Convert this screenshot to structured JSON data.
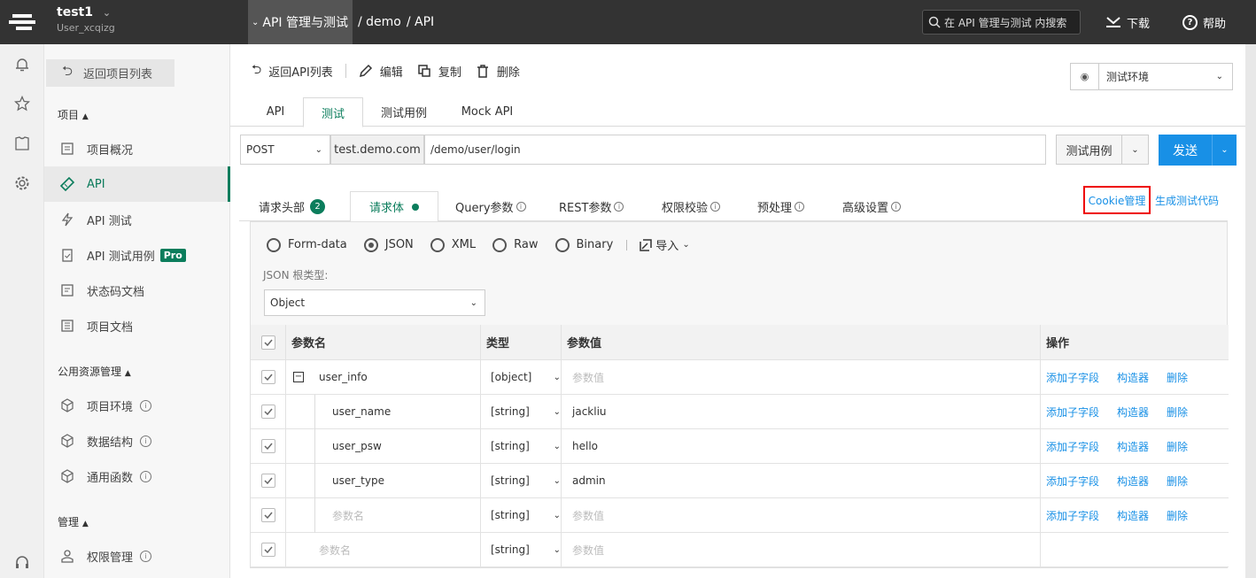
{
  "topbar": {
    "project_name": "test1",
    "user_name": "User_xcqizg",
    "breadcrumb": [
      "API 管理与测试",
      "/ demo",
      "/ API"
    ],
    "search_placeholder": "在 API 管理与测试 内搜索",
    "download_label": "下载",
    "help_label": "帮助"
  },
  "sidebar": {
    "back_label": "返回项目列表",
    "section_project": "项目",
    "section_public": "公用资源管理",
    "section_manage": "管理",
    "items": [
      {
        "label": "项目概况",
        "icon": "overview-icon"
      },
      {
        "label": "API",
        "icon": "api-icon",
        "active": true
      },
      {
        "label": "API 测试",
        "icon": "lightning-icon"
      },
      {
        "label": "API 测试用例",
        "icon": "testcase-icon",
        "badge": "Pro"
      },
      {
        "label": "状态码文档",
        "icon": "doc-icon"
      },
      {
        "label": "项目文档",
        "icon": "list-doc-icon"
      },
      {
        "label": "项目环境",
        "icon": "cube-icon"
      },
      {
        "label": "数据结构",
        "icon": "cube-icon"
      },
      {
        "label": "通用函数",
        "icon": "cube-icon"
      },
      {
        "label": "权限管理",
        "icon": "user-icon"
      }
    ]
  },
  "toolbar": {
    "back_api_list": "返回API列表",
    "edit": "编辑",
    "copy": "复制",
    "delete": "删除",
    "env_selected": "测试环境"
  },
  "tabs_main": [
    "API",
    "测试",
    "测试用例",
    "Mock API"
  ],
  "request": {
    "method": "POST",
    "host": "test.demo.com",
    "path": "/demo/user/login",
    "testcase_btn": "测试用例",
    "send_btn": "发送"
  },
  "tabs_req": {
    "headers": "请求头部",
    "headers_count": "2",
    "body": "请求体",
    "query": "Query参数",
    "rest": "REST参数",
    "auth": "权限校验",
    "pre": "预处理",
    "advanced": "高级设置",
    "info_mark": "i",
    "cookie": "Cookie管理",
    "gencode": "生成测试代码"
  },
  "body": {
    "formats": [
      "Form-data",
      "JSON",
      "XML",
      "Raw",
      "Binary"
    ],
    "selected_format": "JSON",
    "import_label": "导入",
    "json_root_label": "JSON 根类型:",
    "json_root_value": "Object",
    "columns": [
      "参数名",
      "类型",
      "参数值",
      "操作"
    ],
    "rows": [
      {
        "name": "user_info",
        "type": "[object]",
        "value": "参数值",
        "value_placeholder": true,
        "level": 0,
        "expander": true,
        "actions": true
      },
      {
        "name": "user_name",
        "type": "[string]",
        "value": "jackliu",
        "level": 1,
        "actions": true
      },
      {
        "name": "user_psw",
        "type": "[string]",
        "value": "hello",
        "level": 1,
        "actions": true
      },
      {
        "name": "user_type",
        "type": "[string]",
        "value": "admin",
        "level": 1,
        "actions": true
      },
      {
        "name": "参数名",
        "name_placeholder": true,
        "type": "[string]",
        "value": "参数值",
        "value_placeholder": true,
        "level": 1,
        "actions": true
      },
      {
        "name": "参数名",
        "name_placeholder": true,
        "type": "[string]",
        "value": "参数值",
        "value_placeholder": true,
        "level": 0,
        "actions": false
      }
    ],
    "actions": [
      "添加子字段",
      "构造器",
      "删除"
    ]
  }
}
